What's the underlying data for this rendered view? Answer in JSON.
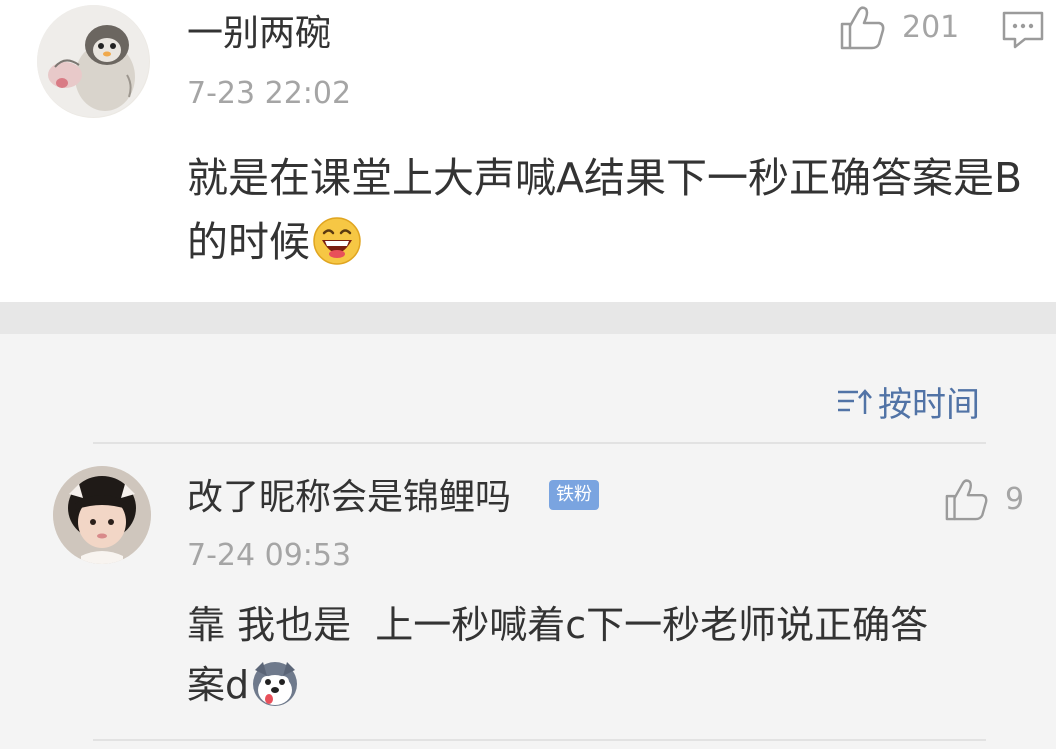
{
  "comment": {
    "username": "一别两碗",
    "timestamp": "7-23 22:02",
    "like_count": "201",
    "text": "就是在课堂上大声喊A结果下一秒正确答案是B的时候",
    "emoji": "laughing-emoji"
  },
  "sort": {
    "label": "按时间",
    "icon": "sort-icon"
  },
  "reply": {
    "username": "改了昵称会是锦鲤吗",
    "badge": "铁粉",
    "timestamp": "7-24 09:53",
    "like_count": "9",
    "text_line1": "靠 我也是  上一秒喊着c下一秒老师说正确答",
    "text_line2": "案d",
    "emoji": "husky-emoji"
  },
  "colors": {
    "link_blue": "#5173a6",
    "badge_blue": "#7aa4e0",
    "meta_gray": "#a5a5a5",
    "text_dark": "#333333"
  }
}
